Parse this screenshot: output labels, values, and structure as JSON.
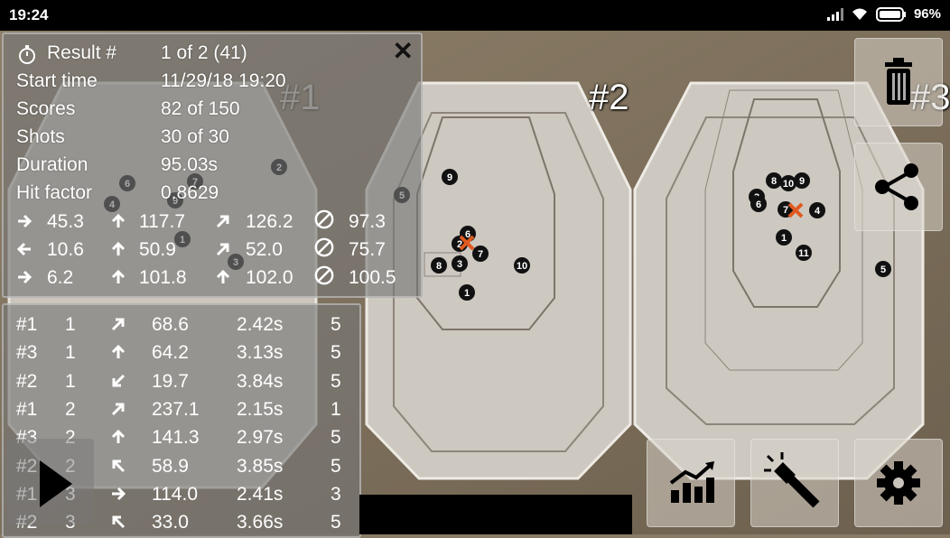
{
  "status": {
    "time": "19:24",
    "battery": "96%"
  },
  "targets": [
    {
      "label": "#1"
    },
    {
      "label": "#2"
    },
    {
      "label": "#3"
    }
  ],
  "result": {
    "result_label": "Result #",
    "result_value": "1 of 2 (41)",
    "start_label": "Start time",
    "start_value": "11/29/18 19:20",
    "scores_label": "Scores",
    "scores_value": "82 of 150",
    "shots_label": "Shots",
    "shots_value": "30 of 30",
    "duration_label": "Duration",
    "duration_value": "95.03s",
    "hit_label": "Hit factor",
    "hit_value": "0.8629",
    "stats": [
      {
        "a": "45.3",
        "b": "117.7",
        "c": "126.2",
        "d": "97.3",
        "ia": "arrow-right-icon",
        "ib": "arrow-up-icon",
        "ic": "arrow-up-right-icon",
        "id": "diameter-icon"
      },
      {
        "a": "10.6",
        "b": "50.9",
        "c": "52.0",
        "d": "75.7",
        "ia": "arrow-left-icon",
        "ib": "arrow-up-icon",
        "ic": "arrow-up-right-icon",
        "id": "diameter-icon"
      },
      {
        "a": "6.2",
        "b": "101.8",
        "c": "102.0",
        "d": "100.5",
        "ia": "arrow-right-icon",
        "ib": "arrow-up-icon",
        "ic": "arrow-up-icon",
        "id": "diameter-icon"
      }
    ]
  },
  "shots": [
    {
      "target": "#1",
      "n": "1",
      "dir": "arrow-up-right-icon",
      "dist": "68.6",
      "time": "2.42s",
      "score": "5"
    },
    {
      "target": "#3",
      "n": "1",
      "dir": "arrow-up-icon",
      "dist": "64.2",
      "time": "3.13s",
      "score": "5"
    },
    {
      "target": "#2",
      "n": "1",
      "dir": "arrow-down-left-icon",
      "dist": "19.7",
      "time": "3.84s",
      "score": "5"
    },
    {
      "target": "#1",
      "n": "2",
      "dir": "arrow-up-right-icon",
      "dist": "237.1",
      "time": "2.15s",
      "score": "1"
    },
    {
      "target": "#3",
      "n": "2",
      "dir": "arrow-up-icon",
      "dist": "141.3",
      "time": "2.97s",
      "score": "5"
    },
    {
      "target": "#2",
      "n": "2",
      "dir": "arrow-up-left-icon",
      "dist": "58.9",
      "time": "3.85s",
      "score": "5"
    },
    {
      "target": "#1",
      "n": "3",
      "dir": "arrow-right-icon",
      "dist": "114.0",
      "time": "2.41s",
      "score": "3"
    },
    {
      "target": "#2",
      "n": "3",
      "dir": "arrow-up-left-icon",
      "dist": "33.0",
      "time": "3.66s",
      "score": "5"
    }
  ],
  "hole_labels": [
    "1",
    "2",
    "3",
    "4",
    "5",
    "6",
    "7",
    "8",
    "9",
    "10",
    "11"
  ]
}
